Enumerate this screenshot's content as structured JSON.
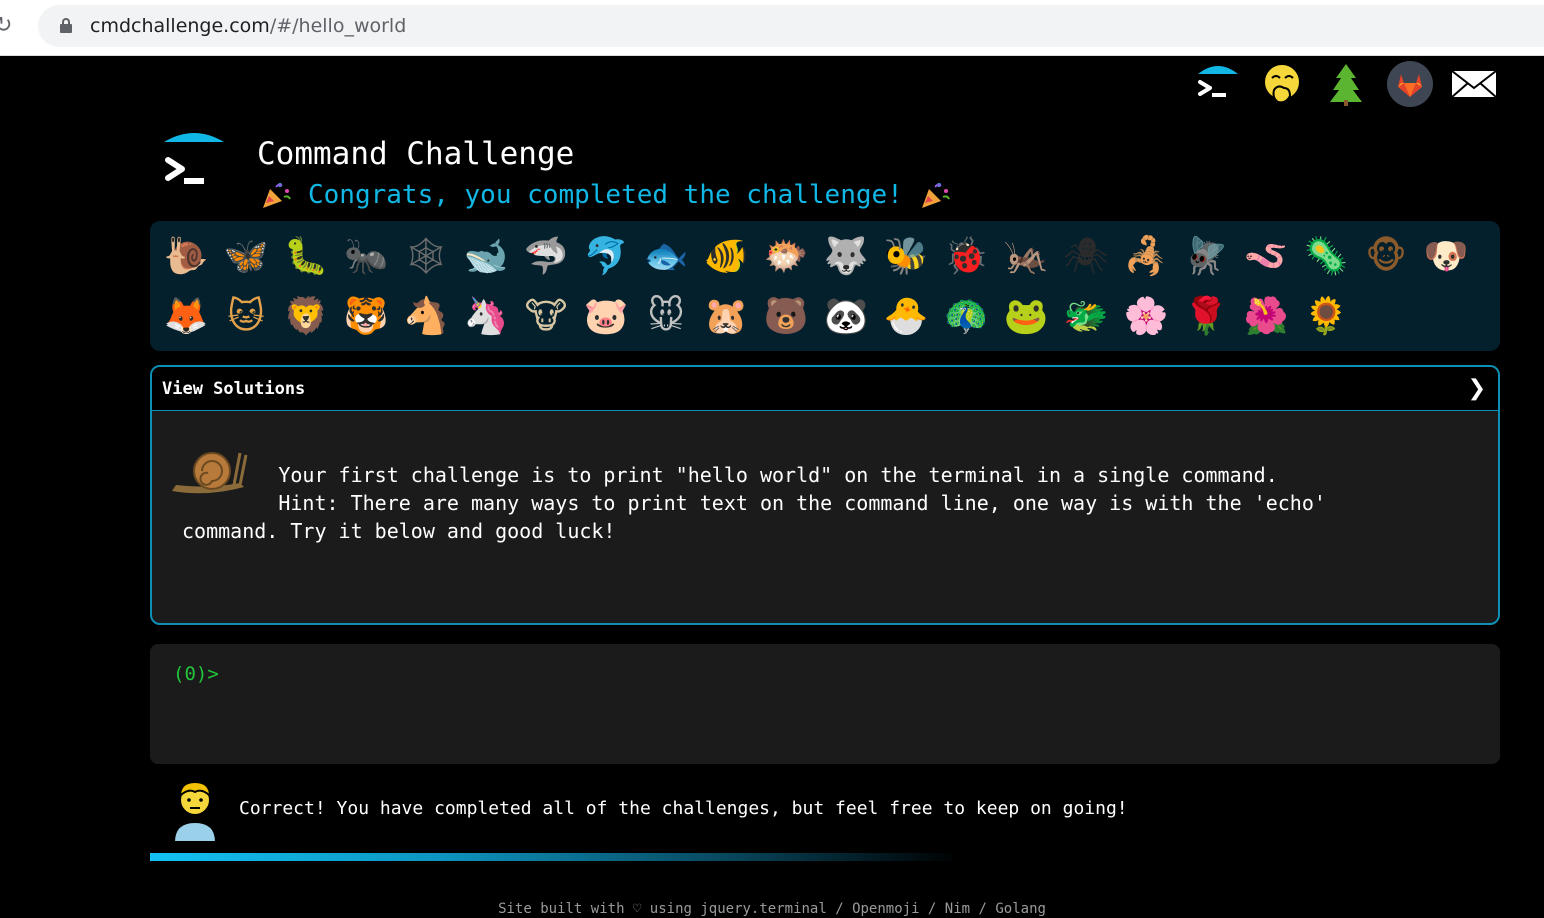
{
  "browser": {
    "url_domain": "cmdchallenge.com",
    "url_path": "/#/hello_world"
  },
  "top_icons": [
    "terminal-logo-icon",
    "face-with-hand-over-mouth-icon",
    "evergreen-tree-icon",
    "gitlab-icon",
    "envelope-icon"
  ],
  "header": {
    "title": "Command Challenge",
    "congrats": "Congrats, you completed the challenge!"
  },
  "badges": [
    {
      "icon": "snail",
      "glyph": "🐌",
      "color": "#b77a3b"
    },
    {
      "icon": "butterfly",
      "glyph": "🦋",
      "color": "#e07b2c"
    },
    {
      "icon": "caterpillar",
      "glyph": "🐛",
      "color": "#5ab02c"
    },
    {
      "icon": "ant",
      "glyph": "🐜",
      "color": "#3b3b3b"
    },
    {
      "icon": "spider-web",
      "glyph": "🕸",
      "color": "#6d6d6d"
    },
    {
      "icon": "whale",
      "glyph": "🐋",
      "color": "#4a91d0"
    },
    {
      "icon": "shark",
      "glyph": "🦈",
      "color": "#4a91d0"
    },
    {
      "icon": "dolphin",
      "glyph": "🐬",
      "color": "#8a8a8a"
    },
    {
      "icon": "fish",
      "glyph": "🐟",
      "color": "#4aa3df"
    },
    {
      "icon": "tropical-fish",
      "glyph": "🐠",
      "color": "#2d6cc0"
    },
    {
      "icon": "blowfish",
      "glyph": "🐡",
      "color": "#8b6b3a"
    },
    {
      "icon": "wolf",
      "glyph": "🐺",
      "color": "#8c8c8c"
    },
    {
      "icon": "bee",
      "glyph": "🐝",
      "color": "#d9c23b"
    },
    {
      "icon": "lady-beetle",
      "glyph": "🐞",
      "color": "#d82c2c"
    },
    {
      "icon": "cricket",
      "glyph": "🦗",
      "color": "#5ab02c"
    },
    {
      "icon": "spider",
      "glyph": "🕷",
      "color": "#2b2b2b"
    },
    {
      "icon": "scorpion",
      "glyph": "🦂",
      "color": "#d23b2b"
    },
    {
      "icon": "fly",
      "glyph": "🪰",
      "color": "#b0b0b0"
    },
    {
      "icon": "worm",
      "glyph": "🪱",
      "color": "#d47aa8"
    },
    {
      "icon": "microbe",
      "glyph": "🦠",
      "color": "#4a91d0"
    },
    {
      "icon": "monkey-face",
      "glyph": "🐵",
      "color": "#8b5a2b"
    },
    {
      "icon": "dog-face",
      "glyph": "🐶",
      "color": "#c9822e"
    },
    {
      "icon": "fox",
      "glyph": "🦊",
      "color": "#e0632c"
    },
    {
      "icon": "cat-face",
      "glyph": "🐱",
      "color": "#e3a14a"
    },
    {
      "icon": "lion",
      "glyph": "🦁",
      "color": "#d9a03b"
    },
    {
      "icon": "tiger-face",
      "glyph": "🐯",
      "color": "#e0822c"
    },
    {
      "icon": "horse",
      "glyph": "🐴",
      "color": "#8b5a2b"
    },
    {
      "icon": "unicorn",
      "glyph": "🦄",
      "color": "#c7d6f2"
    },
    {
      "icon": "cow-face",
      "glyph": "🐮",
      "color": "#d9c7a3"
    },
    {
      "icon": "pig-face",
      "glyph": "🐷",
      "color": "#f2a3b7"
    },
    {
      "icon": "mouse-face",
      "glyph": "🐭",
      "color": "#c0c0c0"
    },
    {
      "icon": "hamster",
      "glyph": "🐹",
      "color": "#e3a14a"
    },
    {
      "icon": "bear",
      "glyph": "🐻",
      "color": "#7a4a2b"
    },
    {
      "icon": "panda",
      "glyph": "🐼",
      "color": "#f2f2f2"
    },
    {
      "icon": "hatching-chick",
      "glyph": "🐣",
      "color": "#f2d83b"
    },
    {
      "icon": "peacock",
      "glyph": "🦚",
      "color": "#2c8a5a"
    },
    {
      "icon": "frog",
      "glyph": "🐸",
      "color": "#6ac23b"
    },
    {
      "icon": "dragon-face",
      "glyph": "🐲",
      "color": "#3a9a5a"
    },
    {
      "icon": "cherry-blossom",
      "glyph": "🌸",
      "color": "#f2a3c7"
    },
    {
      "icon": "rose",
      "glyph": "🌹",
      "color": "#d82c4a"
    },
    {
      "icon": "hibiscus",
      "glyph": "🌺",
      "color": "#e07ab0"
    },
    {
      "icon": "sunflower",
      "glyph": "🌻",
      "color": "#e8d83b"
    }
  ],
  "panel": {
    "heading": "View Solutions",
    "line1": "        Your first challenge is to print \"hello world\" on the terminal in a single command.",
    "line2": "\n        Hint: There are many ways to print text on the command line, one way is with the 'echo'\ncommand. Try it below and good luck!"
  },
  "terminal": {
    "prompt": "(0)>"
  },
  "feedback": {
    "message": "Correct! You have completed all of the challenges, but feel free to keep on going!"
  },
  "progress_fraction": 0.6,
  "footer": {
    "text": "Site built with ♡ using jquery.terminal / Openmoji / Nim / Golang"
  },
  "colors": {
    "accent": "#11b8e6",
    "prompt_green": "#22c33b",
    "panel_border": "#0e8fb5",
    "badge_strip_bg": "#04202c"
  }
}
